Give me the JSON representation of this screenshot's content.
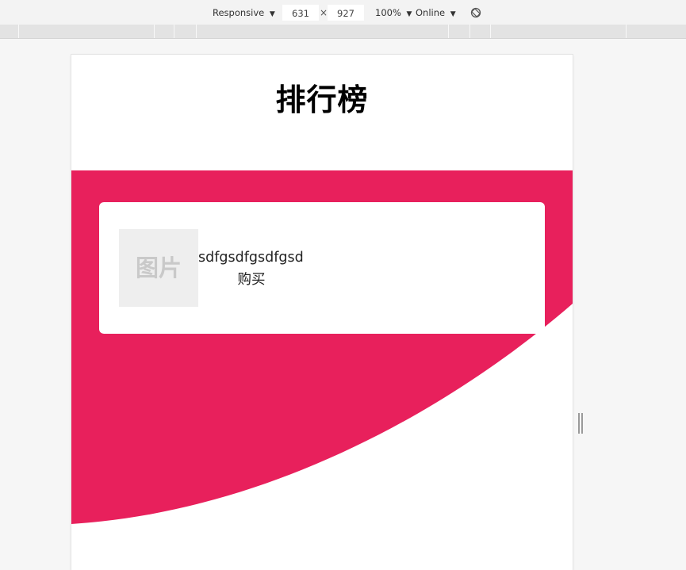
{
  "devtools": {
    "device": "Responsive",
    "width": "631",
    "times": "×",
    "height": "927",
    "zoom": "100%",
    "network": "Online",
    "dropdown_glyph": "▼",
    "icons": [
      "rotate-icon"
    ]
  },
  "page": {
    "title": "排行榜",
    "accent_color": "#e8205c",
    "card": {
      "image_placeholder": "图片",
      "item_name": "sdfgsdfgsdfgsd",
      "buy_label": "购买"
    }
  }
}
